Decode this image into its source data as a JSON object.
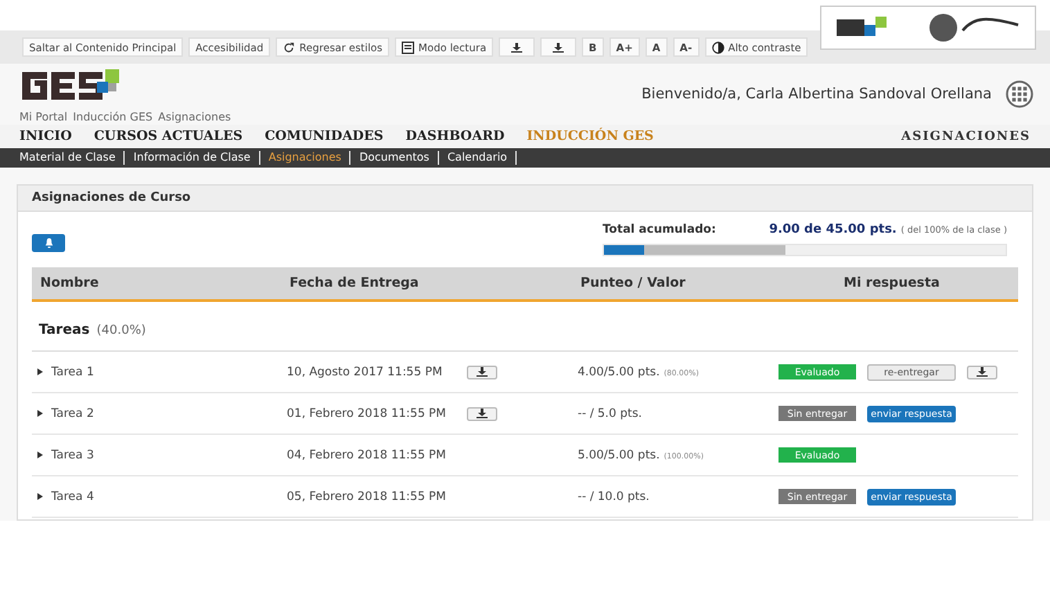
{
  "toolbar": [
    {
      "kind": "text",
      "label": "Saltar al Contenido Principal"
    },
    {
      "kind": "text",
      "label": "Accesibilidad"
    },
    {
      "kind": "text",
      "label": "Regresar estilos"
    },
    {
      "kind": "text",
      "label": "Modo lectura"
    },
    {
      "kind": "icon"
    },
    {
      "kind": "icon"
    },
    {
      "kind": "text",
      "label": "B"
    },
    {
      "kind": "text",
      "label": "A+"
    },
    {
      "kind": "text",
      "label": "A"
    },
    {
      "kind": "text",
      "label": "A-"
    },
    {
      "kind": "text",
      "label": "Alto contraste"
    }
  ],
  "header": {
    "breadcrumb": [
      "Mi Portal",
      "Inducción GES",
      "Asignaciones"
    ],
    "welcome": "Bienvenido/a, Carla Albertina Sandoval Orellana"
  },
  "nav": [
    {
      "label": "INICIO",
      "selected": false
    },
    {
      "label": "CURSOS ACTUALES",
      "selected": false
    },
    {
      "label": "COMUNIDADES",
      "selected": false
    },
    {
      "label": "DASHBOARD",
      "selected": false
    },
    {
      "label": "INDUCCIÓN GES",
      "selected": true
    }
  ],
  "nav_title": "ASIGNACIONES",
  "subnav": [
    {
      "label": "Material de Clase",
      "selected": false
    },
    {
      "label": "Información de Clase",
      "selected": false
    },
    {
      "label": "Asignaciones",
      "selected": true
    },
    {
      "label": "Documentos",
      "selected": false
    },
    {
      "label": "Calendario",
      "selected": false
    }
  ],
  "panel": {
    "title": "Asignaciones de Curso",
    "total": {
      "label": "Total acumulado:",
      "value": "9.00 de 45.00 pts.",
      "note": "( del 100% de la clase )",
      "level": 0.1
    },
    "columns": [
      "Nombre",
      "Fecha de Entrega",
      "Punteo / Valor",
      "Mi respuesta"
    ],
    "group": {
      "name": "Tareas",
      "weight": "(40.0%)"
    },
    "rows": [
      {
        "name": "Tarea 1",
        "date": "10, Agosto 2017 11:55 PM",
        "has_file": true,
        "score": "4.00/5.00 pts.",
        "percent": "(80.00%)",
        "status": {
          "kind": "graded",
          "label": "Evaluado"
        },
        "action": {
          "kind": "resubmit",
          "label": "re-entregar"
        },
        "has_answer_file": true
      },
      {
        "name": "Tarea 2",
        "date": "01, Febrero 2018 11:55 PM",
        "has_file": true,
        "score": "-- / 5.0 pts.",
        "status": {
          "kind": "pending",
          "label": "Sin entregar"
        },
        "action": {
          "kind": "send",
          "label": "enviar respuesta"
        },
        "has_answer_file": false
      },
      {
        "name": "Tarea 3",
        "date": "04, Febrero 2018 11:55 PM",
        "has_file": false,
        "score": "5.00/5.00 pts.",
        "percent": "(100.00%)",
        "status": {
          "kind": "graded",
          "label": "Evaluado"
        },
        "has_answer_file": false
      },
      {
        "name": "Tarea 4",
        "date": "05, Febrero 2018 11:55 PM",
        "has_file": false,
        "score": "-- / 10.0 pts.",
        "status": {
          "kind": "pending",
          "label": "Sin entregar"
        },
        "action": {
          "kind": "send",
          "label": "enviar respuesta"
        },
        "has_answer_file": false
      }
    ]
  }
}
